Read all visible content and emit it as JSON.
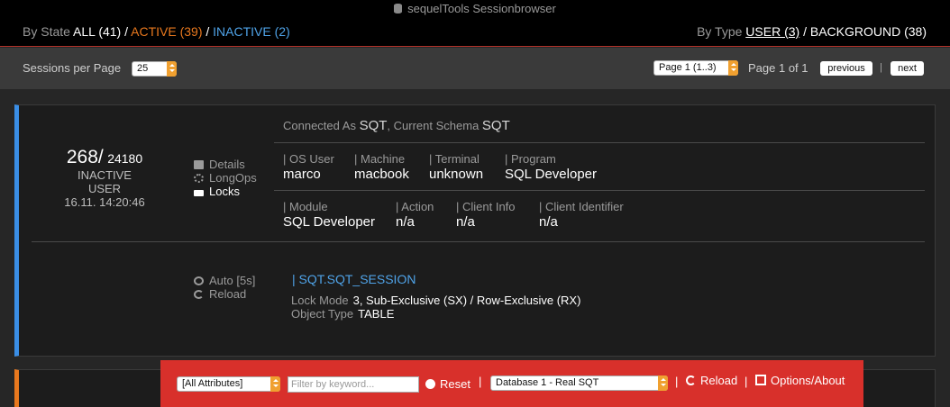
{
  "app": {
    "title": "sequelTools Sessionbrowser"
  },
  "state_filter": {
    "label": "By State",
    "all": "ALL (41)",
    "active": "ACTIVE (39)",
    "inactive": "INACTIVE (2)",
    "sep": "/"
  },
  "type_filter": {
    "label": "By Type",
    "user": "USER (3)",
    "background": "BACKGROUND (38)",
    "sep": "/"
  },
  "paging": {
    "per_page_label": "Sessions per Page",
    "per_page_value": "25",
    "page_select": "Page 1 (1..3)",
    "page_info": "Page 1 of 1",
    "previous": "previous",
    "sep": "|",
    "next": "next"
  },
  "session": {
    "sid": "268/",
    "serial": "24180",
    "status": "INACTIVE",
    "type": "USER",
    "logon_time": "16.11. 14:20:46",
    "menu": {
      "details": "Details",
      "longops": "LongOps",
      "locks": "Locks"
    },
    "connected_as_label": "Connected As",
    "connected_as": "SQT",
    "schema_label": ", Current Schema",
    "schema": "SQT",
    "fields_row1": [
      {
        "label": "| OS User",
        "value": "marco"
      },
      {
        "label": "| Machine",
        "value": "macbook"
      },
      {
        "label": "| Terminal",
        "value": "unknown"
      },
      {
        "label": "| Program",
        "value": "SQL Developer"
      }
    ],
    "fields_row2": [
      {
        "label": "| Module",
        "value": "SQL Developer"
      },
      {
        "label": "| Action",
        "value": "n/a"
      },
      {
        "label": "| Client Info",
        "value": "n/a"
      },
      {
        "label": "| Client Identifier",
        "value": "n/a"
      }
    ],
    "refresh": {
      "auto": "Auto [5s]",
      "reload": "Reload"
    },
    "lock": {
      "object": "| SQT.SQT_SESSION",
      "mode_label": "Lock Mode",
      "mode_value": "3, Sub-Exclusive (SX) / Row-Exclusive (RX)",
      "type_label": "Object Type",
      "type_value": "TABLE"
    }
  },
  "footer": {
    "attributes_select": "[All Attributes]",
    "search_placeholder": "Filter by keyword...",
    "reset": "Reset",
    "database_select": "Database 1 - Real SQT",
    "reload": "Reload",
    "options": "Options/About",
    "sep": "|"
  },
  "colors": {
    "active": "#e8781e",
    "inactive": "#4fa3e8",
    "footer": "#d8302b",
    "card_accent": "#3a8ee6"
  }
}
